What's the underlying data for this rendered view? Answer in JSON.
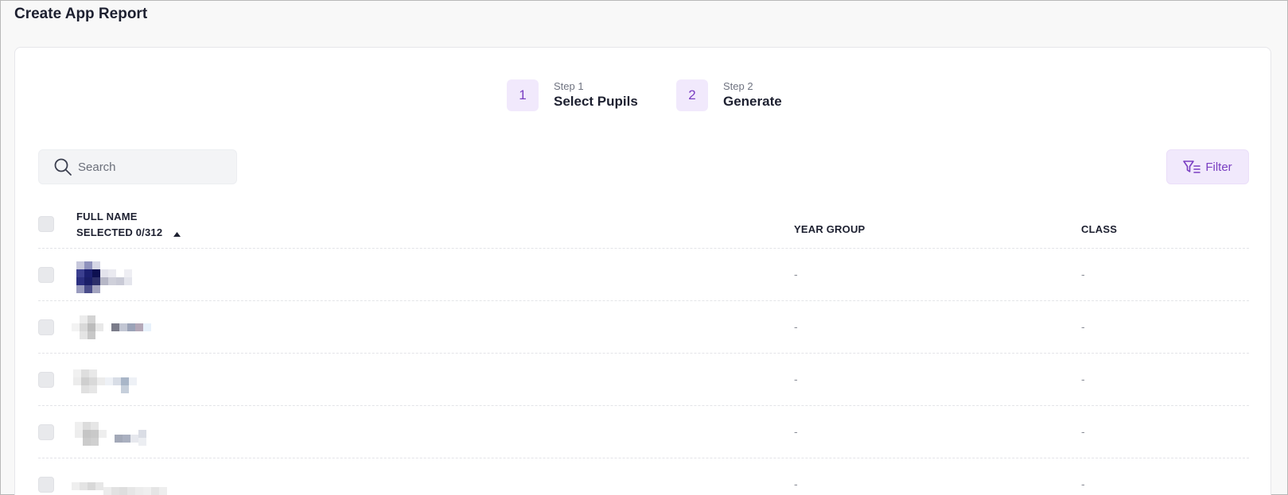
{
  "page": {
    "title": "Create App Report"
  },
  "stepper": {
    "steps": [
      {
        "number": "1",
        "caption": "Step 1",
        "label": "Select Pupils"
      },
      {
        "number": "2",
        "caption": "Step 2",
        "label": "Generate"
      }
    ],
    "accent_color": "#7a3fc2",
    "accent_bg": "#f1e9fc"
  },
  "toolbar": {
    "search_placeholder": "Search",
    "filter_label": "Filter",
    "icons": {
      "search": "search-icon",
      "filter": "filter-icon"
    }
  },
  "table": {
    "headers": {
      "name_line1": "FULL NAME",
      "name_line2": "SELECTED 0/312",
      "year_group": "YEAR GROUP",
      "class": "CLASS"
    },
    "sort_icon": "caret-up-icon",
    "rows": [
      {
        "year_group": "-",
        "class": "-"
      },
      {
        "year_group": "-",
        "class": "-"
      },
      {
        "year_group": "-",
        "class": "-"
      },
      {
        "year_group": "-",
        "class": "-"
      },
      {
        "year_group": "-",
        "class": "-"
      }
    ]
  }
}
